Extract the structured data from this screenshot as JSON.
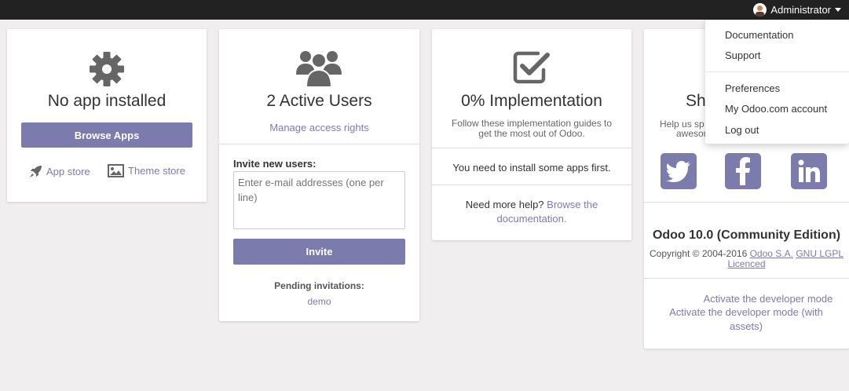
{
  "topbar": {
    "user_name": "Administrator"
  },
  "dropdown": {
    "items": [
      "Documentation",
      "Support",
      "Preferences",
      "My Odoo.com account",
      "Log out"
    ]
  },
  "apps_card": {
    "title": "No app installed",
    "browse_button": "Browse Apps",
    "app_store": "App store",
    "theme_store": "Theme store"
  },
  "users_card": {
    "title": "2 Active Users",
    "manage_link": "Manage access rights",
    "invite_label": "Invite new users:",
    "invite_placeholder": "Enter e-mail addresses (one per line)",
    "invite_button": "Invite",
    "pending_label": "Pending invitations:",
    "pending_user": "demo"
  },
  "impl_card": {
    "title": "0% Implementation",
    "subtitle": "Follow these implementation guides to get the most out of Odoo.",
    "message": "You need to install some apps first.",
    "help_text": "Need more help?",
    "help_link": "Browse the documentation."
  },
  "share_card": {
    "title_visible": "Sh",
    "subtitle_visible_1": "Help us sp",
    "subtitle_visible_2": "awesor",
    "version": "Odoo 10.0 (Community Edition)",
    "copyright": "Copyright © 2004-2016",
    "company_link": "Odoo S.A.",
    "license_link": "GNU LGPL Licenced",
    "dev_mode": "Activate the developer mode",
    "dev_mode_assets": "Activate the developer mode (with assets)"
  },
  "colors": {
    "accent": "#7c7bad",
    "topbar": "#222222",
    "background": "#f0eeee",
    "icon_gray": "#666666"
  },
  "icons": [
    "gear-icon",
    "users-icon",
    "checkbox-icon",
    "rocket-icon",
    "image-icon",
    "twitter-icon",
    "facebook-icon",
    "linkedin-icon",
    "caret-down-icon"
  ]
}
